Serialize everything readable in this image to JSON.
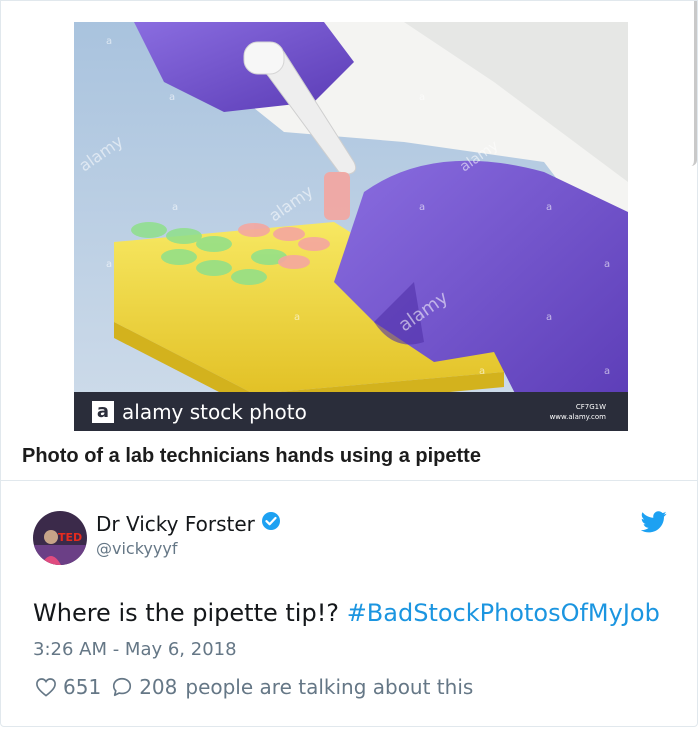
{
  "photo": {
    "watermark": "alamy",
    "watermark_letter": "a",
    "brand_label": "alamy stock photo",
    "image_code": "CF7G1W",
    "site": "www.alamy.com"
  },
  "caption": "Photo of a lab technicians hands using a pipette",
  "tweet": {
    "author_name": "Dr Vicky Forster",
    "author_handle": "@vickyyyf",
    "avatar_text": "TED",
    "text": "Where is the pipette tip!? ",
    "hashtag": "#BadStockPhotosOfMyJob",
    "timestamp": "3:26 AM - May 6, 2018",
    "likes": "651",
    "replies": "208",
    "talking_label": "people are talking about this"
  },
  "colors": {
    "link": "#1b95e0",
    "muted": "#657786",
    "glove": "#6a4bc8",
    "rack": "#f3dc3e"
  }
}
